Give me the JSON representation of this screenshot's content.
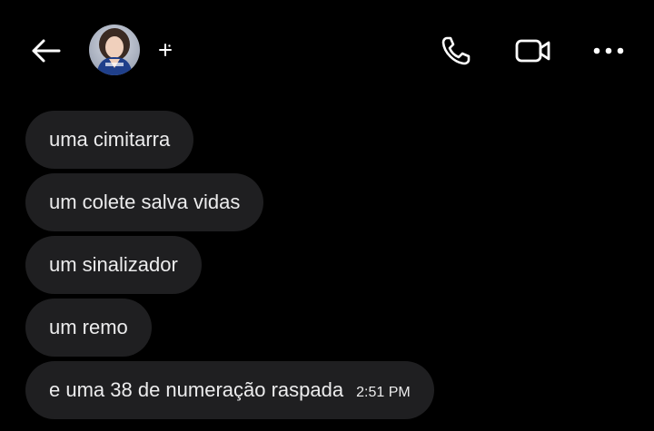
{
  "header": {
    "back_icon": "arrow-left-icon",
    "avatar_icon": "profile-photo",
    "sparkle_icon": "sparkle-icon",
    "call_icon": "phone-icon",
    "video_icon": "video-camera-icon",
    "more_icon": "more-horizontal-icon"
  },
  "messages": [
    {
      "text": "uma cimitarra"
    },
    {
      "text": "um colete salva vidas"
    },
    {
      "text": "um sinalizador"
    },
    {
      "text": "um remo"
    },
    {
      "text": "e uma 38 de numeração raspada",
      "time": "2:51 PM"
    }
  ],
  "colors": {
    "background": "#000000",
    "bubble": "#1f1f21",
    "text": "#ececed"
  }
}
